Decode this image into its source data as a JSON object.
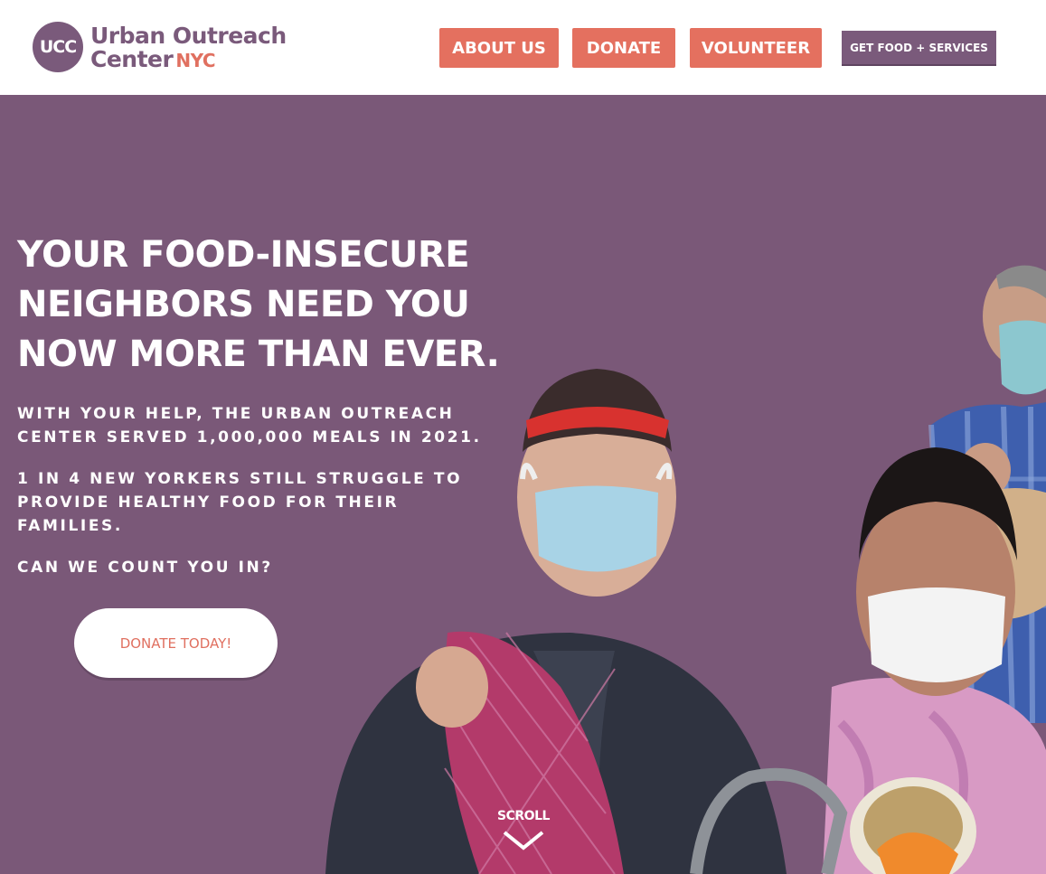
{
  "header": {
    "logo": {
      "mark": "UCC",
      "line1": "Urban Outreach",
      "line2": "Center",
      "nyc": "NYC"
    },
    "nav": [
      {
        "label": "ABOUT US"
      },
      {
        "label": "DONATE"
      },
      {
        "label": "VOLUNTEER"
      },
      {
        "label": "GET FOOD + SERVICES"
      }
    ]
  },
  "hero": {
    "headline_lines": [
      "YOUR FOOD-INSECURE",
      "NEIGHBORS NEED YOU",
      "NOW MORE THAN EVER."
    ],
    "paragraphs": [
      "WITH YOUR HELP, THE URBAN OUTREACH CENTER SERVED 1,000,000 MEALS IN 2021.",
      "1 IN 4 NEW YORKERS STILL STRUGGLE TO PROVIDE HEALTHY FOOD FOR THEIR FAMILIES.",
      "CAN WE COUNT YOU IN?"
    ],
    "cta_label": "DONATE TODAY!",
    "scroll_label": "SCROLL",
    "scroll_icon": "chevron-down-icon"
  },
  "colors": {
    "brand_purple": "#7a5a7b",
    "hero_background": "#7a5878",
    "accent_coral": "#e4705f",
    "white": "#ffffff"
  }
}
